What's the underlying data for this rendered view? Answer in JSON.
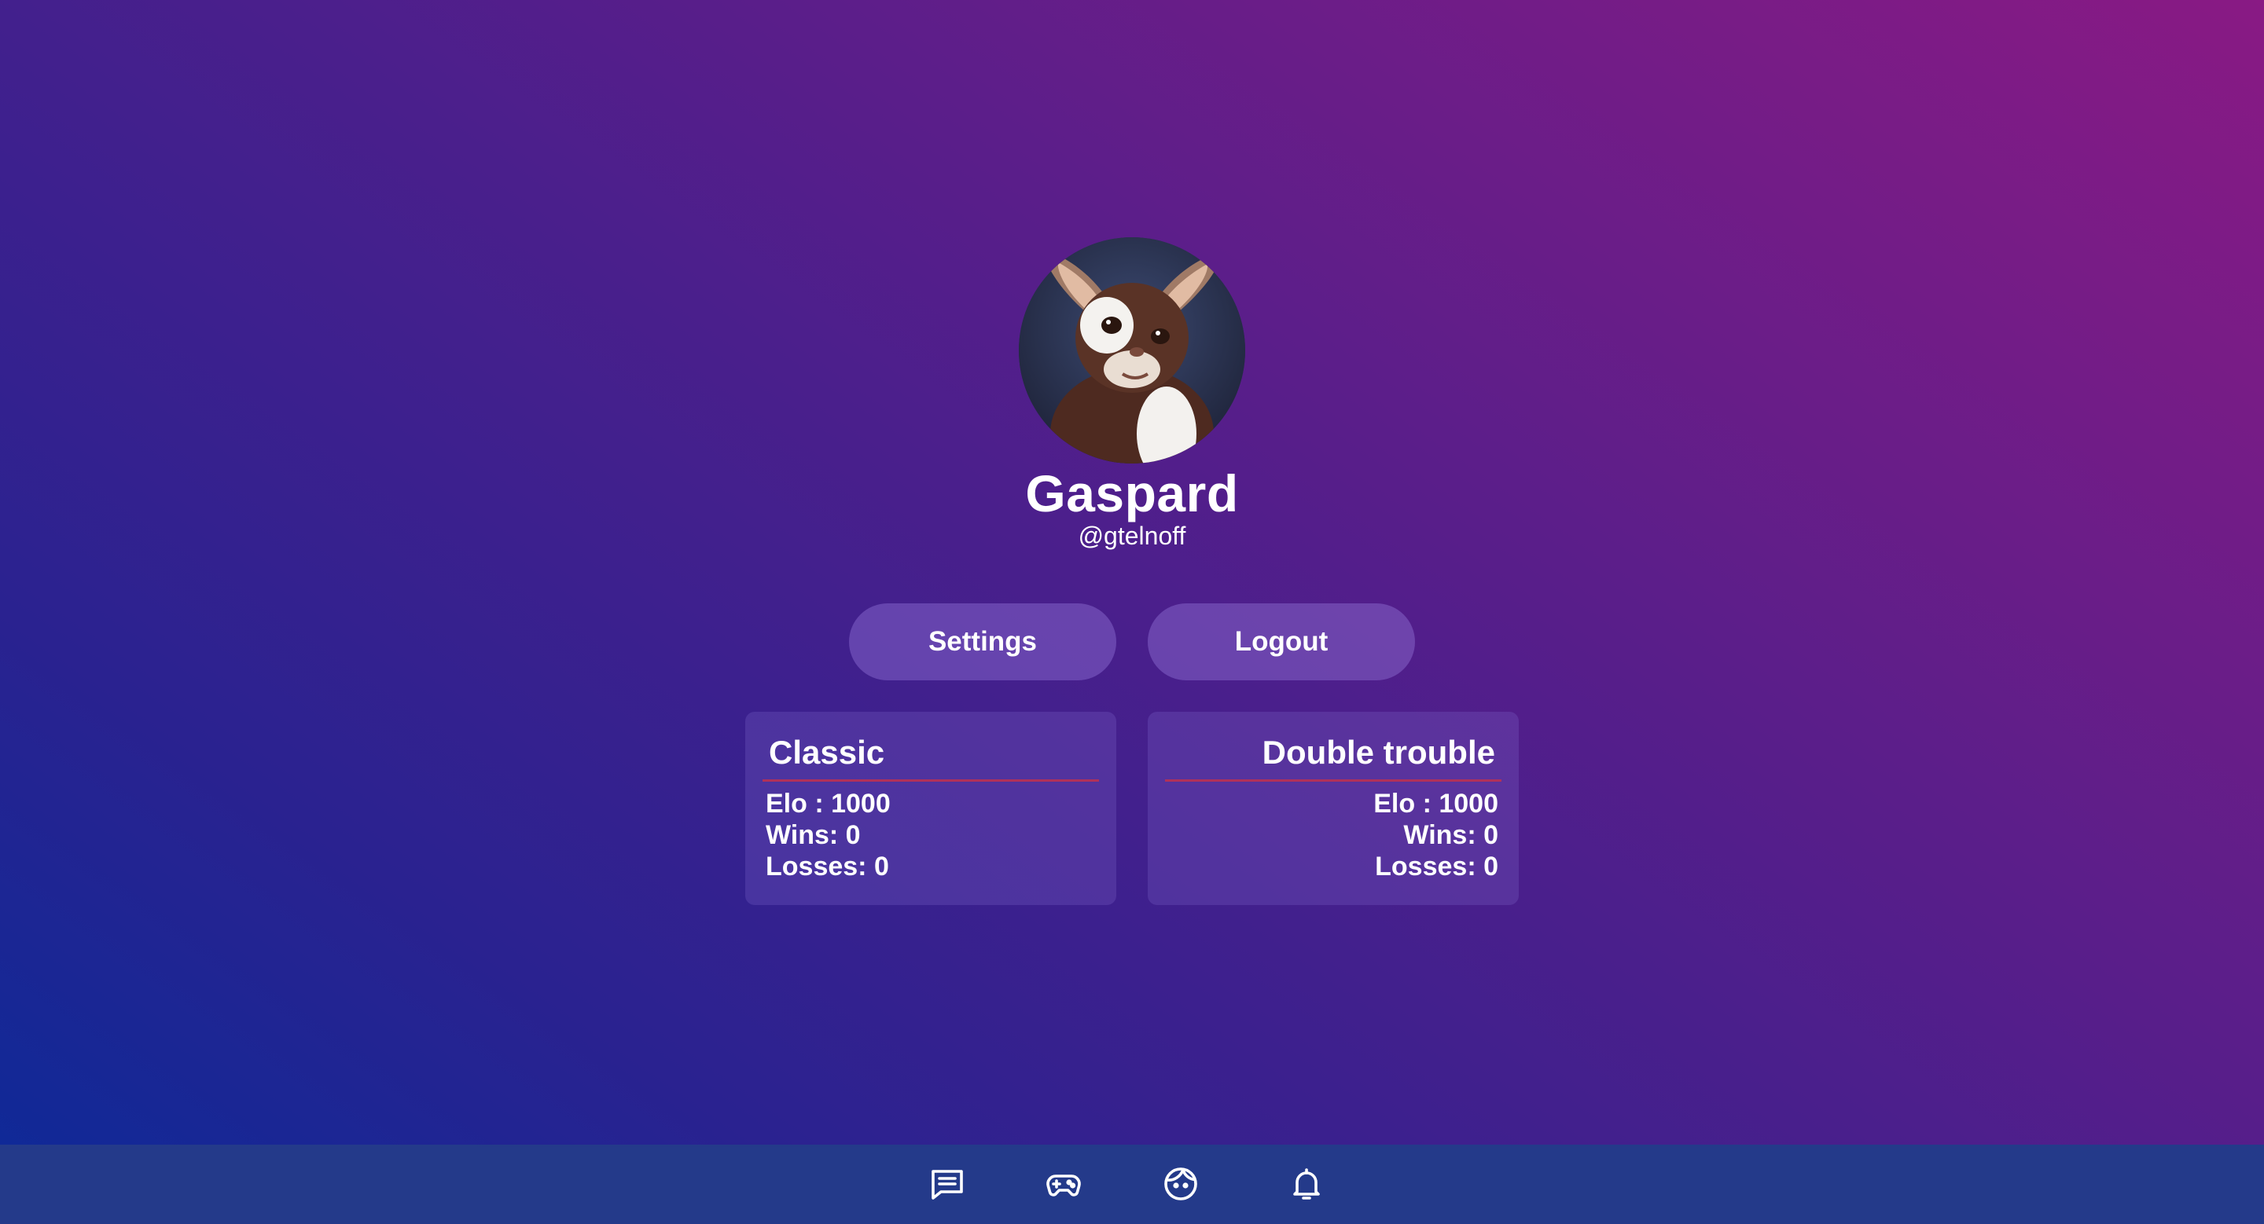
{
  "profile": {
    "display_name": "Gaspard",
    "handle": "@gtelnoff",
    "avatar_icon": "gizmo-avatar"
  },
  "actions": {
    "settings_label": "Settings",
    "logout_label": "Logout"
  },
  "stats": [
    {
      "title": "Classic",
      "elo": "Elo : 1000",
      "wins": "Wins: 0",
      "losses": "Losses: 0"
    },
    {
      "title": "Double trouble",
      "elo": "Elo : 1000",
      "wins": "Wins: 0",
      "losses": "Losses: 0"
    }
  ],
  "nav": {
    "items": [
      "chat-icon",
      "gamepad-icon",
      "profile-face-icon",
      "bell-icon"
    ],
    "background": "#243a8a"
  },
  "colors": {
    "divider": "#b0315a",
    "text": "#ffffff"
  }
}
